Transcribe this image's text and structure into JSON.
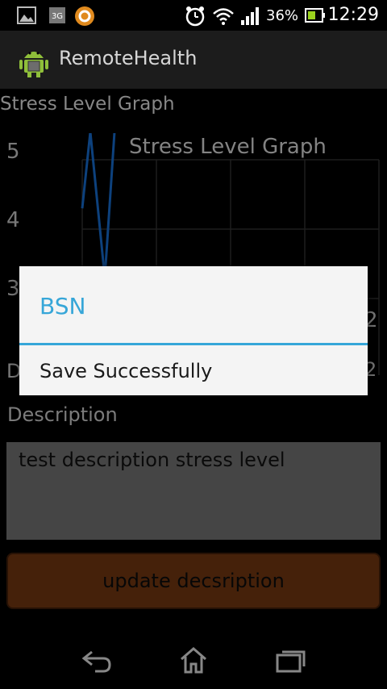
{
  "status_bar": {
    "network": "3G",
    "battery_percent": "36%",
    "time": "12:29"
  },
  "action_bar": {
    "app_title": "RemoteHealth"
  },
  "content": {
    "graph_section_label": "Stress Level Graph",
    "description_label": "Description",
    "description_text": "test description stress level",
    "update_button_label": "update decsription",
    "hidden_row_initial": "D",
    "hidden_right_digit_1": "2",
    "hidden_right_digit_2": "2"
  },
  "chart_data": {
    "type": "line",
    "title": "Stress Level Graph",
    "y_tick_labels": [
      "5",
      "4",
      "3"
    ],
    "series": [
      {
        "values": [
          4.3,
          5.4,
          3.3,
          5.4
        ]
      }
    ],
    "grid": true,
    "colors": {
      "line": "#1565c0",
      "grid": "#2e2e2e"
    }
  },
  "dialog": {
    "title": "BSN",
    "message": "Save Successfully",
    "accent_color": "#36a6d8"
  },
  "nav_bar": {
    "icons": [
      "back-icon",
      "home-icon",
      "recent-apps-icon"
    ]
  }
}
